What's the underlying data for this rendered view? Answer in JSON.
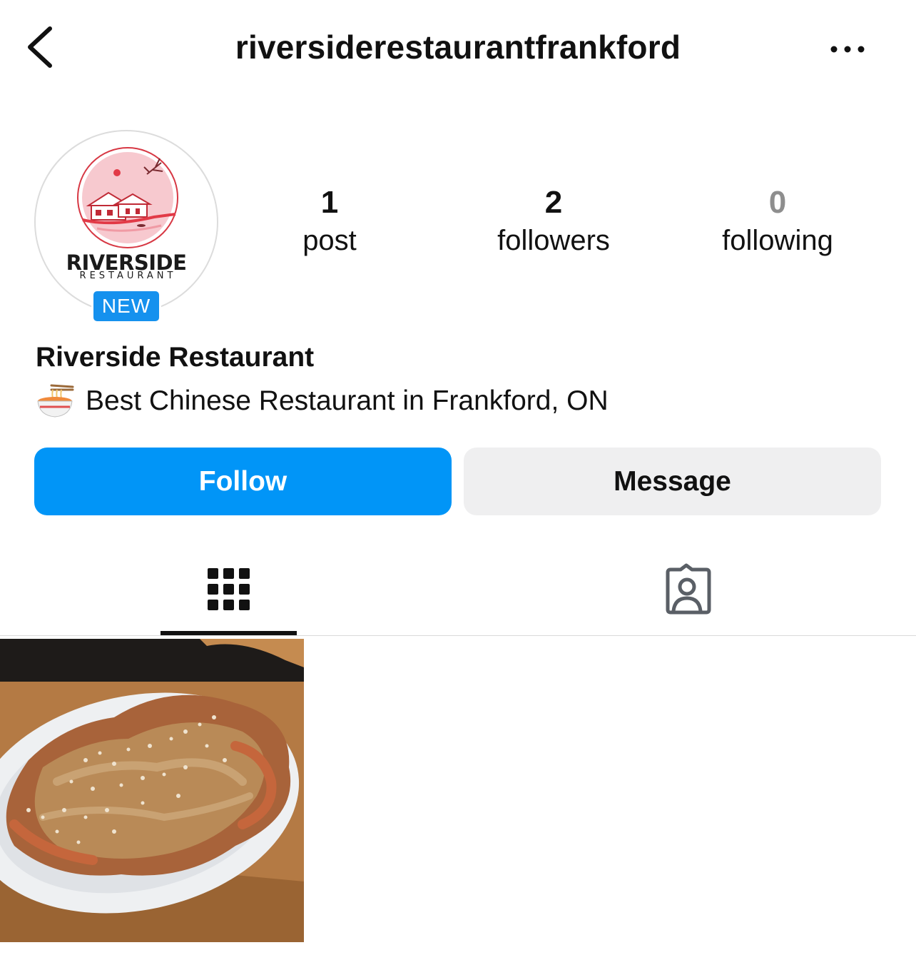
{
  "header": {
    "username": "riversiderestaurantfrankford",
    "back_icon": "chevron-left-icon",
    "more_icon": "more-horizontal-icon"
  },
  "profile": {
    "avatar": {
      "logo_name": "RIVERSIDE",
      "logo_subtitle": "RESTAURANT",
      "badge": "NEW"
    },
    "stats": [
      {
        "count": "1",
        "label": "post"
      },
      {
        "count": "2",
        "label": "followers"
      },
      {
        "count": "0",
        "label": "following"
      }
    ],
    "display_name": "Riverside Restaurant",
    "bio": {
      "emoji": "noodle-bowl-emoji",
      "text": "Best Chinese Restaurant in Frankford, ON"
    }
  },
  "actions": {
    "follow_label": "Follow",
    "message_label": "Message"
  },
  "tabs": [
    {
      "name": "grid",
      "icon": "grid-icon",
      "active": true
    },
    {
      "name": "tagged",
      "icon": "tagged-person-icon",
      "active": false
    }
  ],
  "posts": [
    {
      "image": "food-plate-photo"
    }
  ],
  "colors": {
    "primary_blue": "#0195f7",
    "badge_blue": "#1591ee",
    "secondary_button": "#efeff0",
    "muted_text": "#8e8e8e"
  }
}
